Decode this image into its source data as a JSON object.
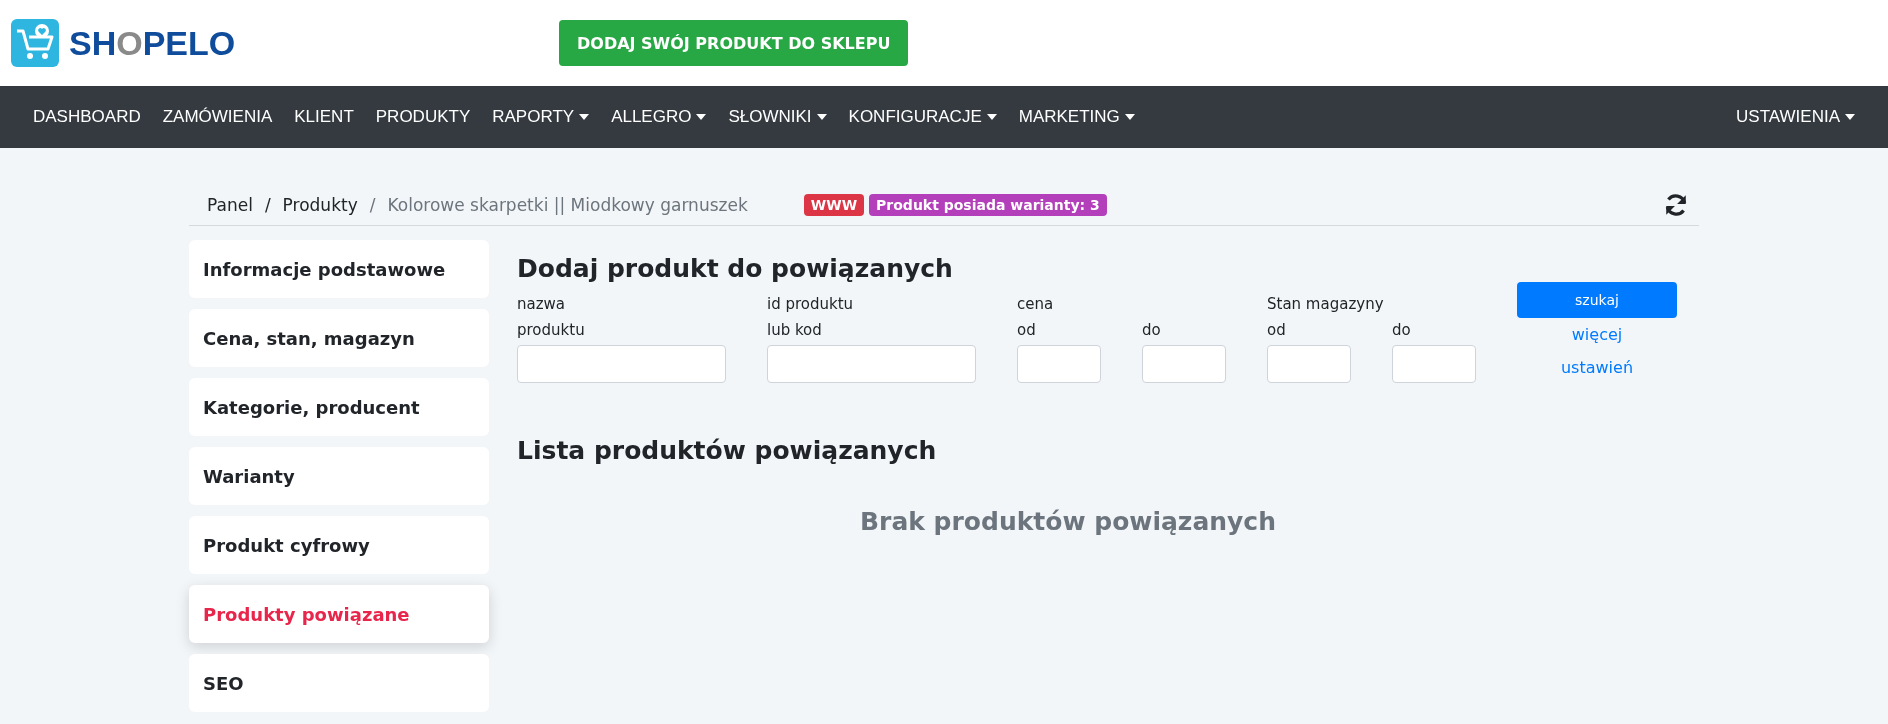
{
  "logo": {
    "parts": [
      {
        "text": "SH",
        "accent": false
      },
      {
        "text": "O",
        "accent": true
      },
      {
        "text": "PELO",
        "accent": false
      }
    ]
  },
  "add_product_button": "DODAJ SWÓJ PRODUKT DO SKLEPU",
  "nav": {
    "items": [
      {
        "label": "DASHBOARD",
        "dropdown": false
      },
      {
        "label": "ZAMÓWIENIA",
        "dropdown": false
      },
      {
        "label": "KLIENT",
        "dropdown": false
      },
      {
        "label": "PRODUKTY",
        "dropdown": false
      },
      {
        "label": "RAPORTY",
        "dropdown": true
      },
      {
        "label": "ALLEGRO",
        "dropdown": true
      },
      {
        "label": "SŁOWNIKI",
        "dropdown": true
      },
      {
        "label": "KONFIGURACJE",
        "dropdown": true
      },
      {
        "label": "MARKETING",
        "dropdown": true
      }
    ],
    "right": {
      "label": "USTAWIENIA",
      "dropdown": true
    }
  },
  "breadcrumb": {
    "items": [
      {
        "label": "Panel",
        "separator": "/"
      },
      {
        "label": "Produkty",
        "separator": "/"
      }
    ],
    "current": "Kolorowe skarpetki || Miodkowy garnuszek"
  },
  "badges": [
    {
      "text": "WWW",
      "color": "#dc3545"
    },
    {
      "text": "Produkt posiada warianty: 3",
      "color": "#b33fbb"
    }
  ],
  "sidebar": {
    "items": [
      {
        "label": "Informacje podstawowe",
        "selected": false
      },
      {
        "label": "Cena, stan, magazyn",
        "selected": false
      },
      {
        "label": "Kategorie, producent",
        "selected": false
      },
      {
        "label": "Warianty",
        "selected": false
      },
      {
        "label": "Produkt cyfrowy",
        "selected": false
      },
      {
        "label": "Produkty powiązane",
        "selected": true
      },
      {
        "label": "SEO",
        "selected": false
      }
    ]
  },
  "search": {
    "title": "Dodaj produkt do powiązanych",
    "groups": [
      {
        "title": "nazwa",
        "fields": [
          {
            "label": "produktu",
            "kind": "wide"
          }
        ]
      },
      {
        "title": "id produktu",
        "fields": [
          {
            "label": "lub kod",
            "kind": "wide"
          }
        ]
      },
      {
        "title": "cena",
        "fields": [
          {
            "label": "od",
            "kind": "narrow"
          },
          {
            "label": "do",
            "kind": "narrow"
          }
        ]
      },
      {
        "title": "Stan magazyny",
        "fields": [
          {
            "label": "od",
            "kind": "narrow"
          },
          {
            "label": "do",
            "kind": "narrow"
          }
        ]
      }
    ],
    "button": "szukaj",
    "more_link": "więcej ustawień"
  },
  "related": {
    "title": "Lista produktów powiązanych",
    "empty": "Brak produktów powiązanych"
  }
}
